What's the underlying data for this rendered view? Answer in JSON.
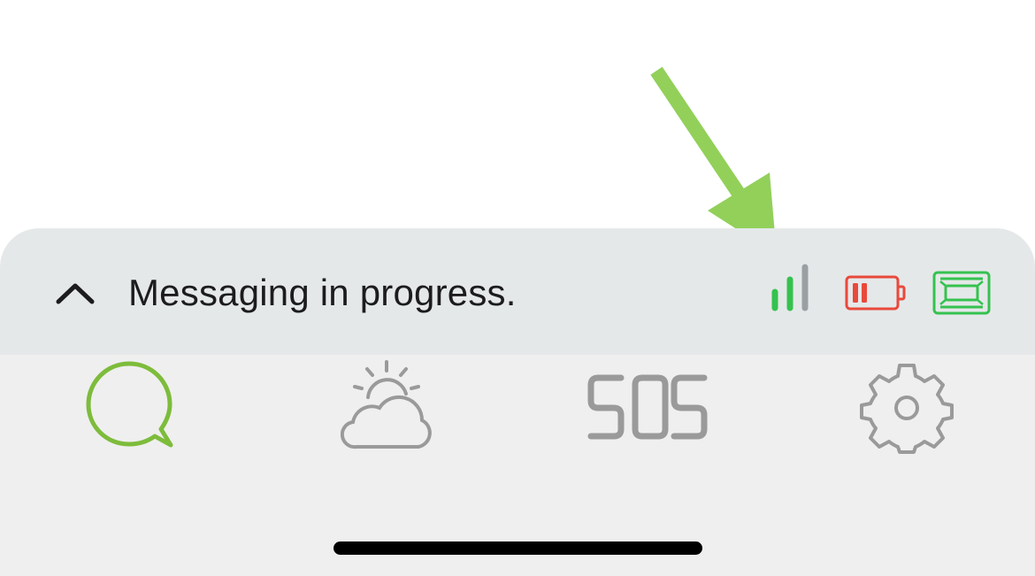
{
  "status_bar": {
    "expand_icon": "chevron-up-icon",
    "message": "Messaging in progress.",
    "signal_icon": "signal-bars-icon",
    "signal_color": "#35c24f",
    "battery_icon": "battery-low-icon",
    "battery_color": "#e9493b",
    "device_icon": "satellite-device-icon",
    "device_color": "#35c24f"
  },
  "tabs": [
    {
      "id": "messages",
      "icon": "chat-bubble-icon",
      "active": true,
      "color": "#7dbc3b"
    },
    {
      "id": "weather",
      "icon": "weather-cloud-sun-icon",
      "active": false,
      "color": "#9a9a9a"
    },
    {
      "id": "sos",
      "icon": "sos-icon",
      "label": "SOS",
      "active": false,
      "color": "#9a9a9a"
    },
    {
      "id": "settings",
      "icon": "gear-icon",
      "active": false,
      "color": "#9a9a9a"
    }
  ],
  "annotation": {
    "arrow_color": "#92d05a"
  }
}
